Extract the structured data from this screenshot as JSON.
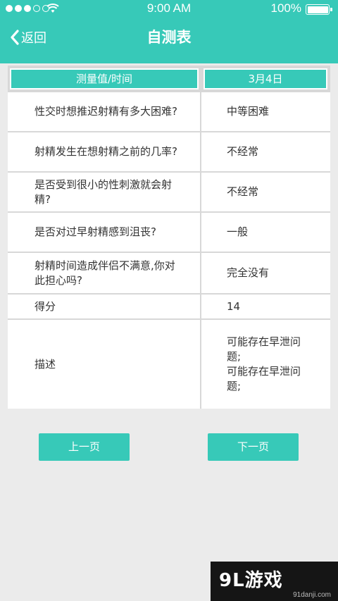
{
  "status_bar": {
    "time": "9:00 AM",
    "battery": "100%",
    "signal_bars_filled": 3,
    "signal_bars_total": 5
  },
  "nav": {
    "back_label": "返回",
    "title": "自测表"
  },
  "table": {
    "headers": [
      "测量值/时间",
      "3月4日"
    ],
    "rows": [
      {
        "question": "性交时想推迟射精有多大困难?",
        "answer": "中等困难"
      },
      {
        "question": "射精发生在想射精之前的几率?",
        "answer": "不经常"
      },
      {
        "question": "是否受到很小的性刺激就会射精?",
        "answer": "不经常"
      },
      {
        "question": "是否对过早射精感到沮丧?",
        "answer": "一般"
      },
      {
        "question": "射精时间造成伴侣不满意,你对此担心吗?",
        "answer": "完全没有"
      },
      {
        "question": "得分",
        "answer": "14"
      },
      {
        "question": "描述",
        "answer": "可能存在早泄问题;\n可能存在早泄问题;"
      }
    ]
  },
  "buttons": {
    "prev": "上一页",
    "next": "下一页"
  },
  "watermark": {
    "brand": "9L游戏",
    "url": "91danji.com"
  },
  "colors": {
    "accent": "#37c9b8",
    "background": "#ebebeb"
  }
}
